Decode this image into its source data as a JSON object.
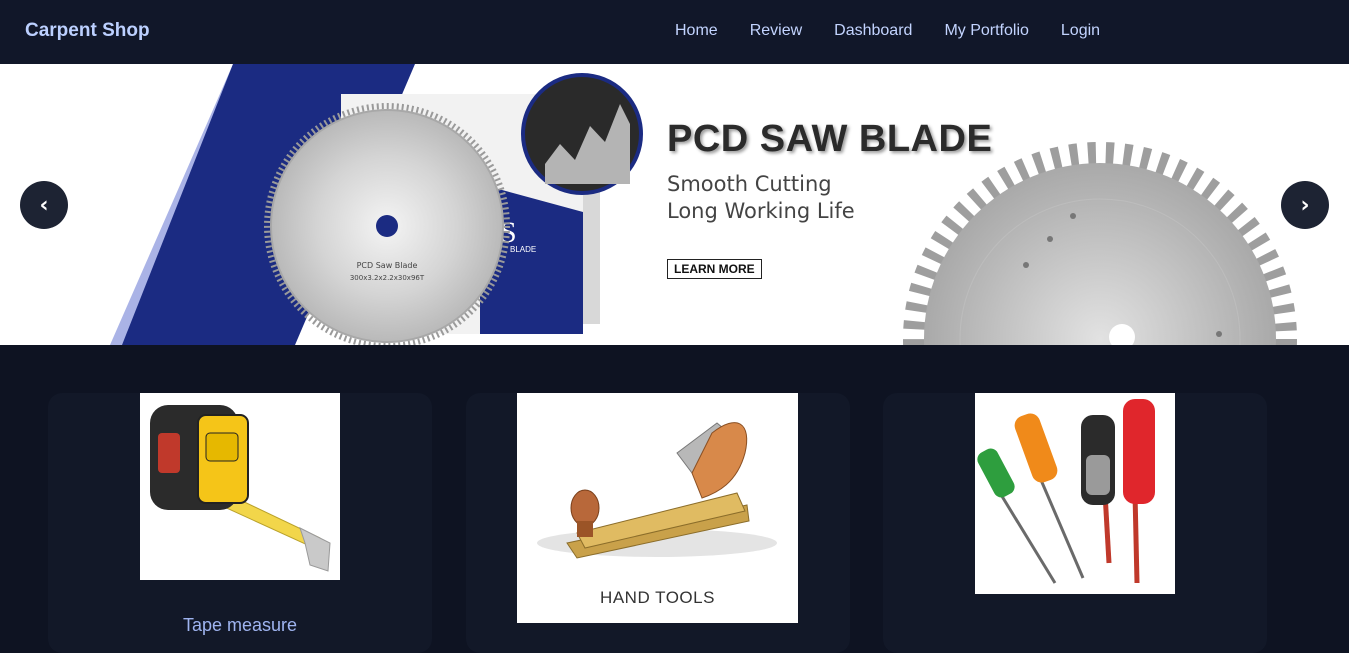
{
  "brand": "Carpent Shop",
  "nav": {
    "items": [
      "Home",
      "Review",
      "Dashboard",
      "My Portfolio",
      "Login"
    ]
  },
  "banner": {
    "headline": "PCD SAW BLADE",
    "subline1": "Smooth Cutting",
    "subline2": "Long Working Life",
    "cta": "LEARN MORE",
    "blade_label_1": "PCD Saw Blade",
    "blade_label_2": "300x3.2x2.2x30x96T",
    "box_text": "S",
    "box_small": "BLADE"
  },
  "carousel": {
    "prev_glyph": "‹",
    "next_glyph": "›"
  },
  "products": [
    {
      "title": "Tape measure",
      "caption": ""
    },
    {
      "title": "",
      "caption": "HAND TOOLS"
    },
    {
      "title": "",
      "caption": ""
    }
  ],
  "colors": {
    "nav_bg": "#111729",
    "page_bg": "#0e1322",
    "brand_text": "#bcd0ff",
    "banner_blue": "#1b2b82",
    "banner_light_blue": "#aab3e6"
  }
}
